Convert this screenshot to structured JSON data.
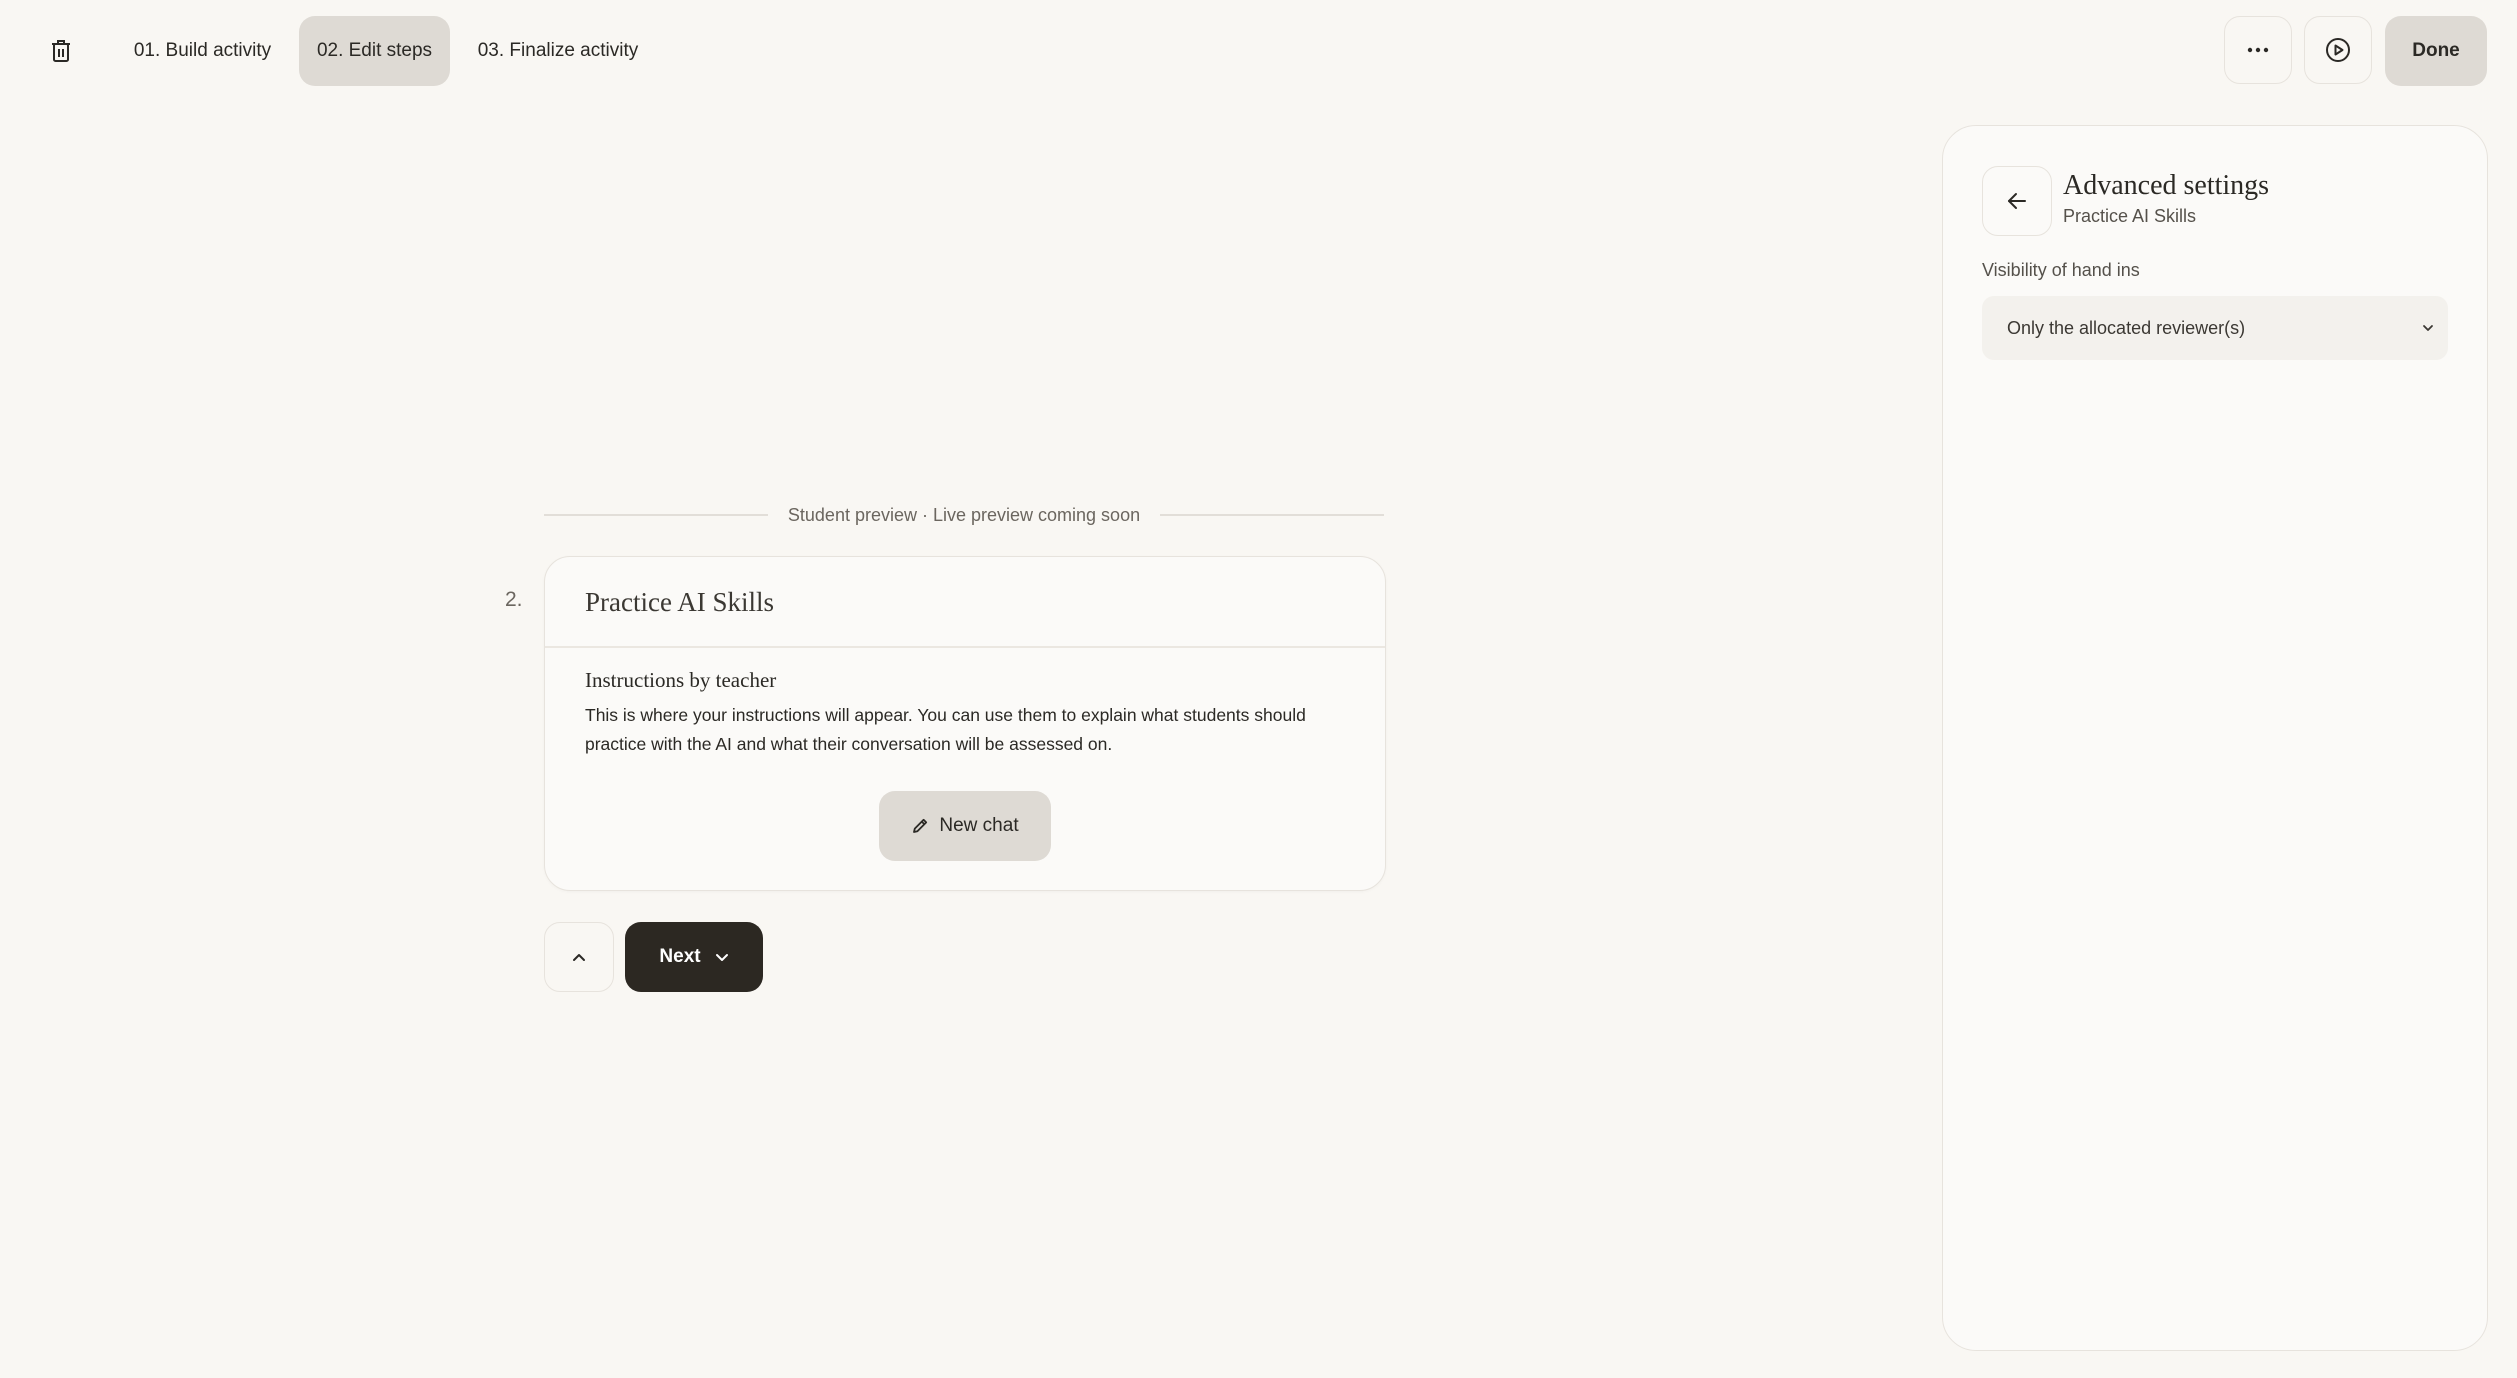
{
  "header": {
    "tabs": [
      {
        "label": "01. Build activity"
      },
      {
        "label": "02. Edit steps"
      },
      {
        "label": "03. Finalize activity"
      }
    ],
    "done_label": "Done"
  },
  "preview": {
    "label": "Student preview · Live preview coming soon",
    "step_number": "2.",
    "title": "Practice AI Skills",
    "subtitle": "Instructions by teacher",
    "body": "This is where your instructions will appear. You can use them to explain what students should practice with the AI and what their conversation will be assessed on.",
    "new_chat_label": "New chat",
    "next_label": "Next"
  },
  "panel": {
    "title": "Advanced settings",
    "subtitle": "Practice AI Skills",
    "visibility_label": "Visibility of hand ins",
    "visibility_value": "Only the allocated reviewer(s)"
  },
  "icons": {
    "delete": "trash-icon",
    "more": "more-horizontal-icon",
    "play": "play-circle-icon",
    "pencil": "pencil-icon",
    "chevron_up": "chevron-up-icon",
    "chevron_down": "chevron-down-icon",
    "back": "arrow-left-icon"
  }
}
